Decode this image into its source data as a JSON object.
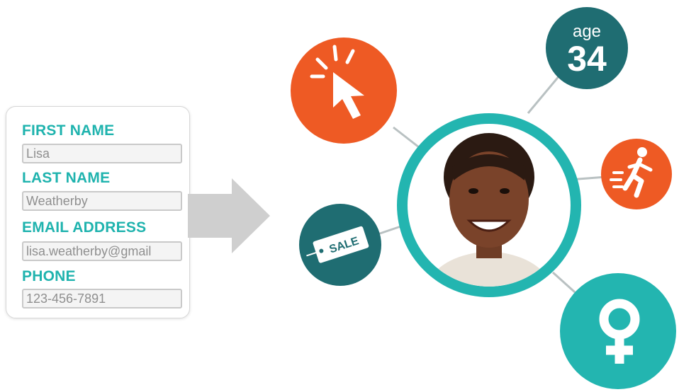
{
  "colors": {
    "teal": "#23b5b0",
    "orange": "#ee5a24",
    "dark_teal": "#1f6d72",
    "label": "#1fb3ae",
    "line": "#b9c1c2",
    "arrow": "#cfcfcf"
  },
  "form": {
    "fields": [
      {
        "label": "FIRST NAME",
        "value": "Lisa"
      },
      {
        "label": "LAST NAME",
        "value": "Weatherby"
      },
      {
        "label": "EMAIL ADDRESS",
        "value": "lisa.weatherby@gmail"
      },
      {
        "label": "PHONE",
        "value": "123-456-7891"
      }
    ]
  },
  "profile": {
    "age_label": "age",
    "age_value": "34",
    "sale_tag": "SALE",
    "icons": [
      "cursor-click-icon",
      "running-person-icon",
      "sale-tag-icon",
      "female-symbol-icon",
      "portrait-avatar"
    ]
  }
}
